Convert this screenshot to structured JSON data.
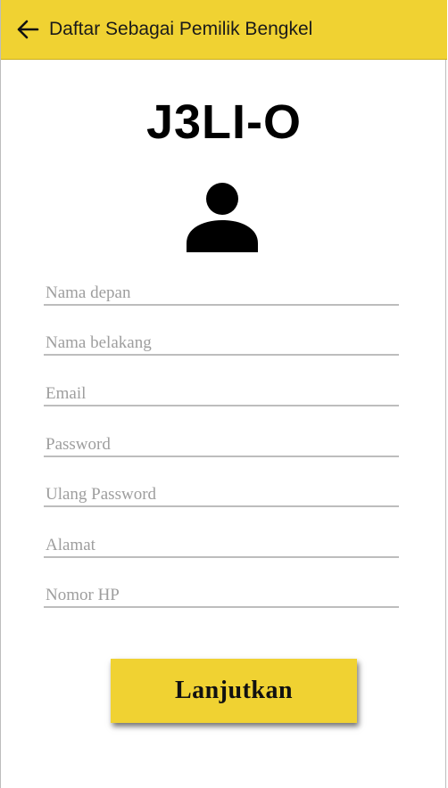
{
  "appbar": {
    "title": "Daftar Sebagai Pemilik Bengkel",
    "back_icon": "arrow-left-icon",
    "color": "#f0d232"
  },
  "logo": {
    "title": "J3LI-O",
    "avatar_icon": "person-icon"
  },
  "form": {
    "fields": [
      {
        "placeholder": "Nama depan",
        "value": ""
      },
      {
        "placeholder": "Nama belakang",
        "value": ""
      },
      {
        "placeholder": "Email",
        "value": ""
      },
      {
        "placeholder": "Password",
        "value": ""
      },
      {
        "placeholder": "Ulang Password",
        "value": ""
      },
      {
        "placeholder": "Alamat",
        "value": ""
      },
      {
        "placeholder": "Nomor HP",
        "value": ""
      }
    ],
    "submit_label": "Lanjutkan"
  }
}
